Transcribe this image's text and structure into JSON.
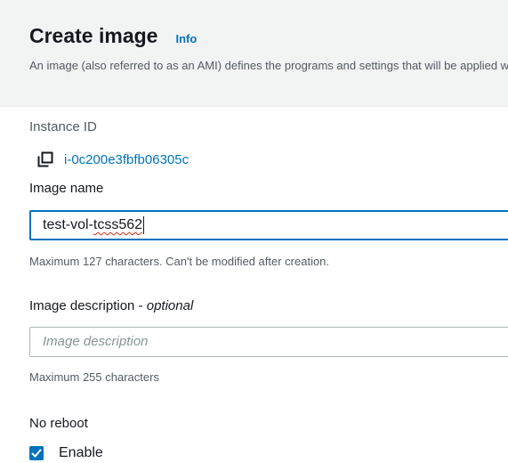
{
  "header": {
    "title": "Create image",
    "info_link": "Info",
    "description": "An image (also referred to as an AMI) defines the programs and settings that will be applied when you launch an instance."
  },
  "instance": {
    "label": "Instance ID",
    "id": "i-0c200e3fbfb06305c",
    "copy_icon": "copy-icon"
  },
  "image_name": {
    "label": "Image name",
    "value_prefix": "test-vol-",
    "value_misspelled": "tcss562",
    "hint": "Maximum 127 characters. Can't be modified after creation."
  },
  "image_description": {
    "label_main": "Image description - ",
    "label_optional": "optional",
    "placeholder": "Image description",
    "hint": "Maximum 255 characters"
  },
  "no_reboot": {
    "label": "No reboot",
    "checkbox_label": "Enable",
    "checked": true
  },
  "colors": {
    "link": "#0073bb",
    "focus_border": "#0073bb",
    "header_bg": "#f2f3f3",
    "spellcheck": "#d13212"
  }
}
